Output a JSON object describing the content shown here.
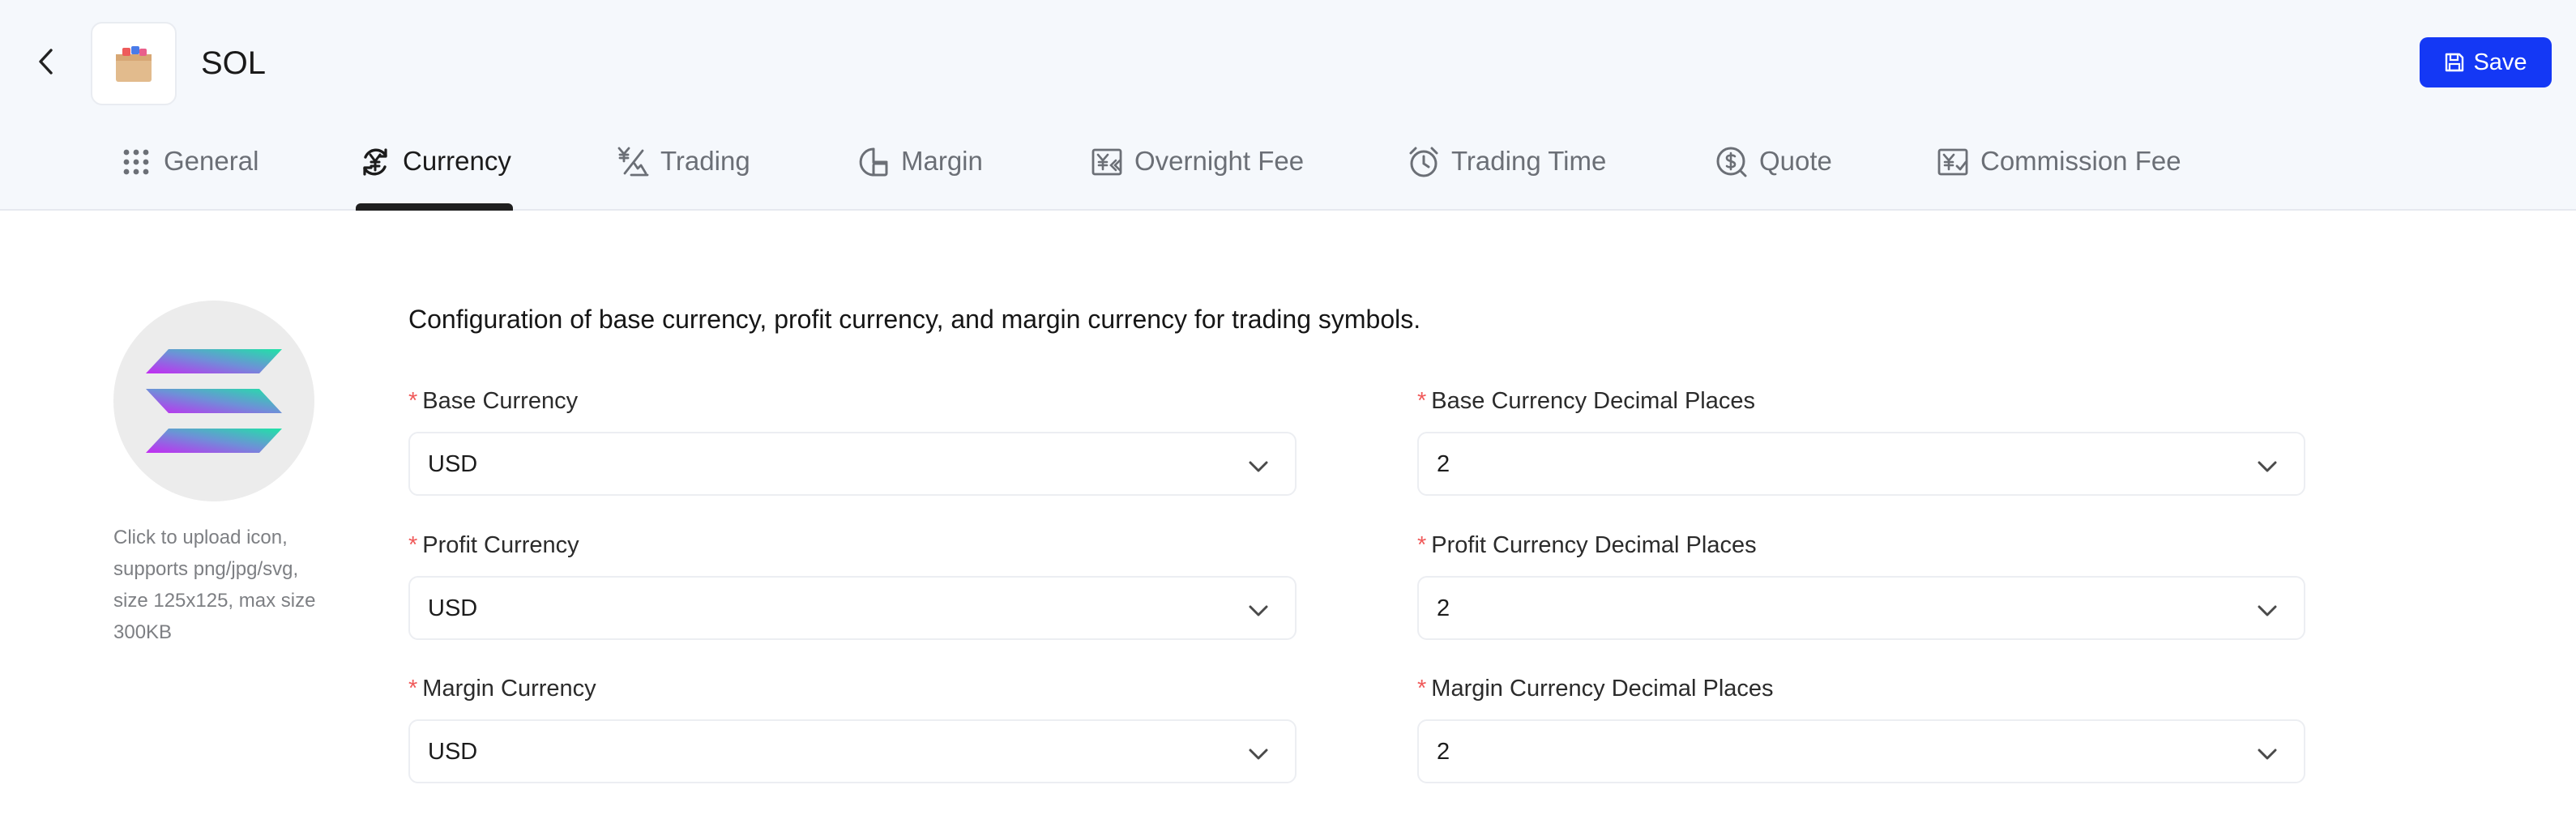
{
  "header": {
    "symbol": "SOL",
    "save_label": "Save"
  },
  "tabs": [
    {
      "label": "General",
      "icon": "grid-dots-icon"
    },
    {
      "label": "Currency",
      "icon": "currency-exchange-icon",
      "active": true
    },
    {
      "label": "Trading",
      "icon": "trading-yen-icon"
    },
    {
      "label": "Margin",
      "icon": "margin-chart-icon"
    },
    {
      "label": "Overnight Fee",
      "icon": "overnight-fee-icon"
    },
    {
      "label": "Trading Time",
      "icon": "alarm-clock-icon"
    },
    {
      "label": "Quote",
      "icon": "dollar-search-icon"
    },
    {
      "label": "Commission Fee",
      "icon": "commission-fee-icon"
    }
  ],
  "content": {
    "description": "Configuration of base currency, profit currency, and margin currency for trading symbols.",
    "upload_hint": "Click to upload icon, supports png/jpg/svg, size 125x125, max size 300KB",
    "fields": {
      "base_currency": {
        "label": "Base Currency",
        "value": "USD"
      },
      "base_decimals": {
        "label": "Base Currency Decimal Places",
        "value": "2"
      },
      "profit_currency": {
        "label": "Profit Currency",
        "value": "USD"
      },
      "profit_decimals": {
        "label": "Profit Currency Decimal Places",
        "value": "2"
      },
      "margin_currency": {
        "label": "Margin Currency",
        "value": "USD"
      },
      "margin_decimals": {
        "label": "Margin Currency Decimal Places",
        "value": "2"
      }
    },
    "required_mark": "*"
  },
  "colors": {
    "primary": "#1438f5",
    "header_bg": "#f5f8fc",
    "required": "#f05a5a"
  }
}
